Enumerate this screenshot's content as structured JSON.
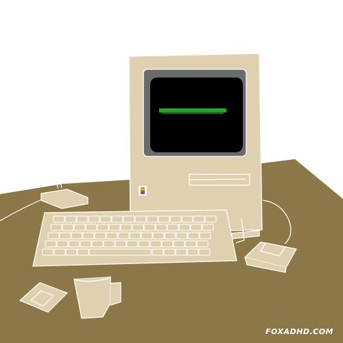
{
  "scene": {
    "description_items": [
      "desk",
      "desk-lamp",
      "computer",
      "keyboard",
      "mouse",
      "floppy-disk",
      "mug"
    ],
    "colors": {
      "desk": "#8b7747",
      "computer": "#dfd1b0",
      "screen_bezel": "#6b6b6b",
      "screen": "#000000",
      "screen_glow": "#2fbf3a",
      "outline": "#ffffff"
    }
  },
  "watermark": {
    "text": "FOXADHD.COM"
  }
}
